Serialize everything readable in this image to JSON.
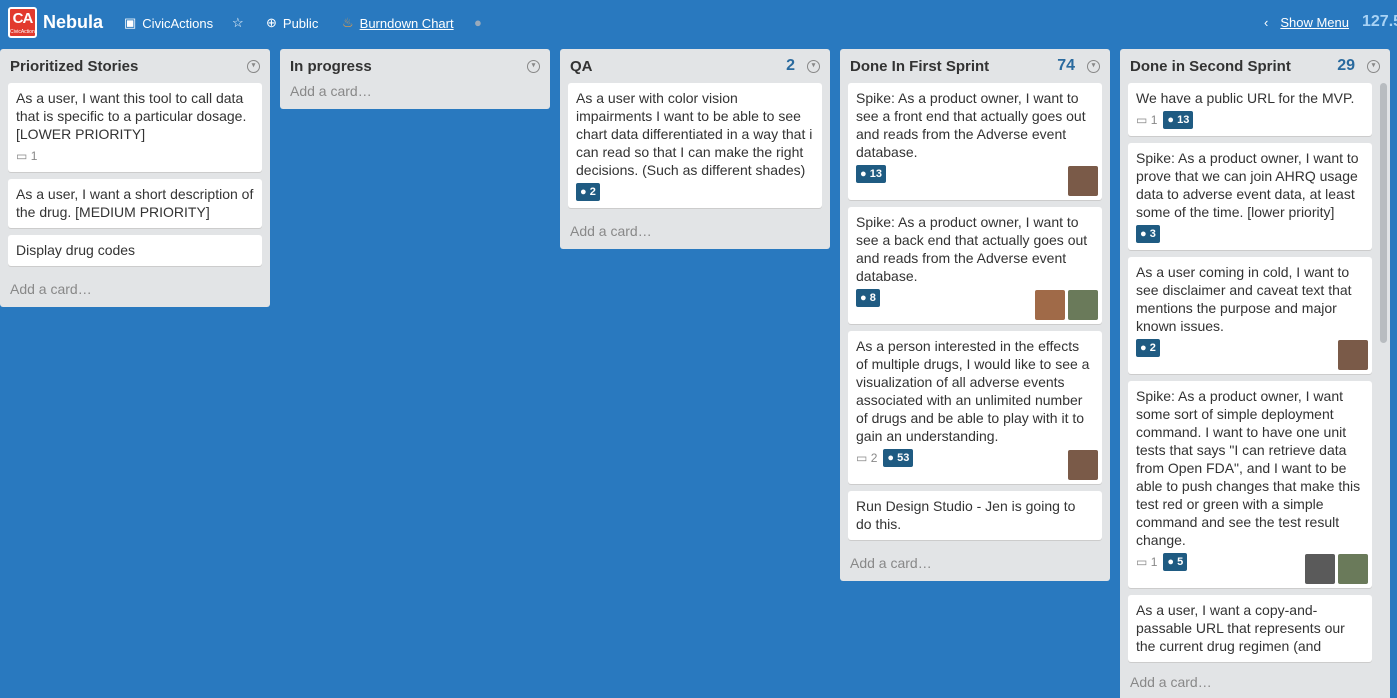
{
  "header": {
    "logo_text": "CA",
    "logo_sub": "CivicActions",
    "board_name": "Nebula",
    "org": "CivicActions",
    "visibility": "Public",
    "burndown": "Burndown Chart",
    "show_menu": "Show Menu",
    "points_total": "127.5"
  },
  "lists": [
    {
      "title": "Prioritized Stories",
      "count": "",
      "cards": [
        {
          "text": "As a user, I want this tool to call data that is specific to a particular dosage. [LOWER PRIORITY]",
          "comments": "1",
          "points": ""
        },
        {
          "text": "As a user, I want a short description of the drug. [MEDIUM PRIORITY]",
          "comments": "",
          "points": ""
        },
        {
          "text": "Display drug codes",
          "comments": "",
          "points": ""
        }
      ],
      "add_label": "Add a card…"
    },
    {
      "title": "In progress",
      "count": "",
      "cards": [],
      "add_label": "Add a card…"
    },
    {
      "title": "QA",
      "count": "2",
      "cards": [
        {
          "text": "As a user with color vision impairments I want to be able to see chart data differentiated in a way that i can read so that I can make the right decisions. (Such as different shades)",
          "comments": "",
          "points": "2"
        }
      ],
      "add_label": "Add a card…"
    },
    {
      "title": "Done In First Sprint",
      "count": "74",
      "cards": [
        {
          "text": "Spike: As a product owner, I want to see a front end that actually goes out and reads from the Adverse event database.",
          "comments": "",
          "points": "13"
        },
        {
          "text": "Spike: As a product owner, I want to see a back end that actually goes out and reads from the Adverse event database.",
          "comments": "",
          "points": "8"
        },
        {
          "text": "As a person interested in the effects of multiple drugs, I would like to see a visualization of all adverse events associated with an unlimited number of drugs and be able to play with it to gain an understanding.",
          "comments": "2",
          "points": "53"
        },
        {
          "text": "Run Design Studio - Jen is going to do this.",
          "comments": "",
          "points": ""
        }
      ],
      "add_label": "Add a card…"
    },
    {
      "title": "Done in Second Sprint",
      "count": "29",
      "cards": [
        {
          "text": "We have a public URL for the MVP.",
          "comments": "1",
          "points": "13"
        },
        {
          "text": "Spike: As a product owner, I want to prove that we can join AHRQ usage data to adverse event data, at least some of the time. [lower priority]",
          "comments": "",
          "points": "3"
        },
        {
          "text": "As a user coming in cold, I want to see disclaimer and caveat text that mentions the purpose and major known issues.",
          "comments": "",
          "points": "2"
        },
        {
          "text": "Spike: As a product owner, I want some sort of simple deployment command. I want to have one unit tests that says \"I can retrieve data from Open FDA\", and I want to be able to push changes that make this test red or green with a simple command and see the test result change.",
          "comments": "1",
          "points": "5"
        },
        {
          "text": "As a user, I want a copy-and-passable URL that represents our the current drug regimen (and",
          "comments": "",
          "points": ""
        }
      ],
      "add_label": "Add a card…"
    }
  ],
  "colors": {
    "background": "#2979bf",
    "list_bg": "#e2e4e6",
    "badge": "#1f5b82",
    "logo": "#e23a2e"
  }
}
